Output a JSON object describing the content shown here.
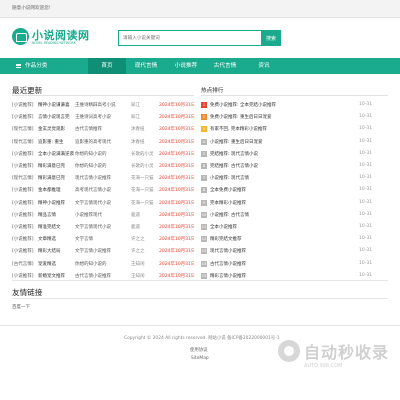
{
  "topbar": {
    "welcome": "随意小说网欢迎您!"
  },
  "logo": {
    "title": "小说阅读网",
    "subtitle": "NOVEL READING NETWORK"
  },
  "search": {
    "placeholder": "请输入小说关键词",
    "button": "搜索"
  },
  "nav": {
    "category": "作品分类",
    "items": [
      "首页",
      "现代言情",
      "小说推荐",
      "古代言情",
      "资讯"
    ]
  },
  "latest": {
    "title": "最近更新",
    "rows": [
      {
        "cat": "[小说推荐]",
        "name": "精神小说谦谦喜",
        "chap": "王维诗精辟高考小说",
        "author": "知江",
        "date": "2024年10月31日"
      },
      {
        "cat": "[小说推荐]",
        "name": "言情小说现言完",
        "chap": "王维诗词高考小说",
        "author": "知江",
        "date": "2024年10月31日"
      },
      {
        "cat": "[现代言情]",
        "name": "金玄灵觉观影",
        "chap": "古代言情推荐",
        "author": "沐春扭",
        "date": "2024年10月31日"
      },
      {
        "cat": "[现代言情]",
        "name": "追影重: 重生",
        "chap": "追影重的高考现代",
        "author": "沐春扭",
        "date": "2024年10月31日"
      },
      {
        "cat": "[小说推荐]",
        "name": "全本小说满满逆袭",
        "chap": "你想的知小说的",
        "author": "长歌的小灵",
        "date": "2024年10月31日"
      },
      {
        "cat": "[小说推荐]",
        "name": "精彩满意已完",
        "chap": "你想的知小说的",
        "author": "长歌的小灵",
        "date": "2024年10月31日"
      },
      {
        "cat": "[现代言情]",
        "name": "精彩满意已完",
        "chap": "现代言情小说推荐",
        "author": "花海一只猫",
        "date": "2024年10月31日"
      },
      {
        "cat": "[小说推荐]",
        "name": "金本都推理",
        "chap": "高考现代言情小说",
        "author": "花海一只猫",
        "date": "2024年10月31日"
      },
      {
        "cat": "[小说推荐]",
        "name": "精神小说推荐",
        "chap": "文学言情现代小说",
        "author": "花海一只猫",
        "date": "2024年10月31日"
      },
      {
        "cat": "[小说推荐]",
        "name": "精品言情",
        "chap": "小说推荐现代",
        "author": "鹿遥",
        "date": "2024年10月31日"
      },
      {
        "cat": "[小说推荐]",
        "name": "精准完结文",
        "chap": "文学言情现代小说",
        "author": "鹿遥",
        "date": "2024年10月31日"
      },
      {
        "cat": "[小说推荐]",
        "name": "文章精选",
        "chap": "文学言情",
        "author": "许之之",
        "date": "2024年10月31日"
      },
      {
        "cat": "[小说推荐]",
        "name": "精彩大结局",
        "chap": "文学言情小说推荐",
        "author": "许之之",
        "date": "2024年10月31日"
      },
      {
        "cat": "[古代言情]",
        "name": "宠爱精选",
        "chap": "你想的知小说的",
        "author": "王知闲",
        "date": "2024年10月31日"
      },
      {
        "cat": "[小说推荐]",
        "name": "新婚宠文推荐",
        "chap": "古代言情小说推荐",
        "author": "王知闲",
        "date": "2024年10月31日"
      }
    ]
  },
  "hot": {
    "title": "热点排行",
    "rows": [
      {
        "n": "1",
        "t": "免费小说推荐: 全本完结小说推荐",
        "d": "10-31"
      },
      {
        "n": "2",
        "t": "免费小说推荐: 重生后日日宠爱",
        "d": "10-31"
      },
      {
        "n": "3",
        "t": "有家不回, 完本精彩小说推荐",
        "d": "10-31"
      },
      {
        "n": "4",
        "t": "小说推荐: 重生后日日宠爱",
        "d": "10-31"
      },
      {
        "n": "5",
        "t": "完结推荐: 现代言情小说",
        "d": "10-31"
      },
      {
        "n": "6",
        "t": "完结推荐: 古代言情小说",
        "d": "10-31"
      },
      {
        "n": "7",
        "t": "小说推荐: 现代言情",
        "d": "10-31"
      },
      {
        "n": "8",
        "t": "全本免费小说推荐",
        "d": "10-31"
      },
      {
        "n": "9",
        "t": "完本精彩小说推荐",
        "d": "10-31"
      },
      {
        "n": "10",
        "t": "小说推荐: 古代言情",
        "d": "10-31"
      },
      {
        "n": "11",
        "t": "全本小说推荐",
        "d": "10-31"
      },
      {
        "n": "12",
        "t": "精彩完结文推荐",
        "d": "10-31"
      },
      {
        "n": "13",
        "t": "现代言情小说推荐",
        "d": "10-31"
      },
      {
        "n": "14",
        "t": "古代言情小说推荐",
        "d": "10-31"
      },
      {
        "n": "15",
        "t": "精彩言情小说推荐",
        "d": "10-31"
      }
    ]
  },
  "links": {
    "title": "友情链接",
    "item": "百度一下"
  },
  "footer": {
    "copyright": "Copyright © 2024 All rights reserved. 网站小说 备ICP备2022000001号-1",
    "line1": "使用协议",
    "line2": "SiteMap"
  },
  "watermark": {
    "big": "自动秒收录",
    "small": "AUTO.998.COM"
  }
}
